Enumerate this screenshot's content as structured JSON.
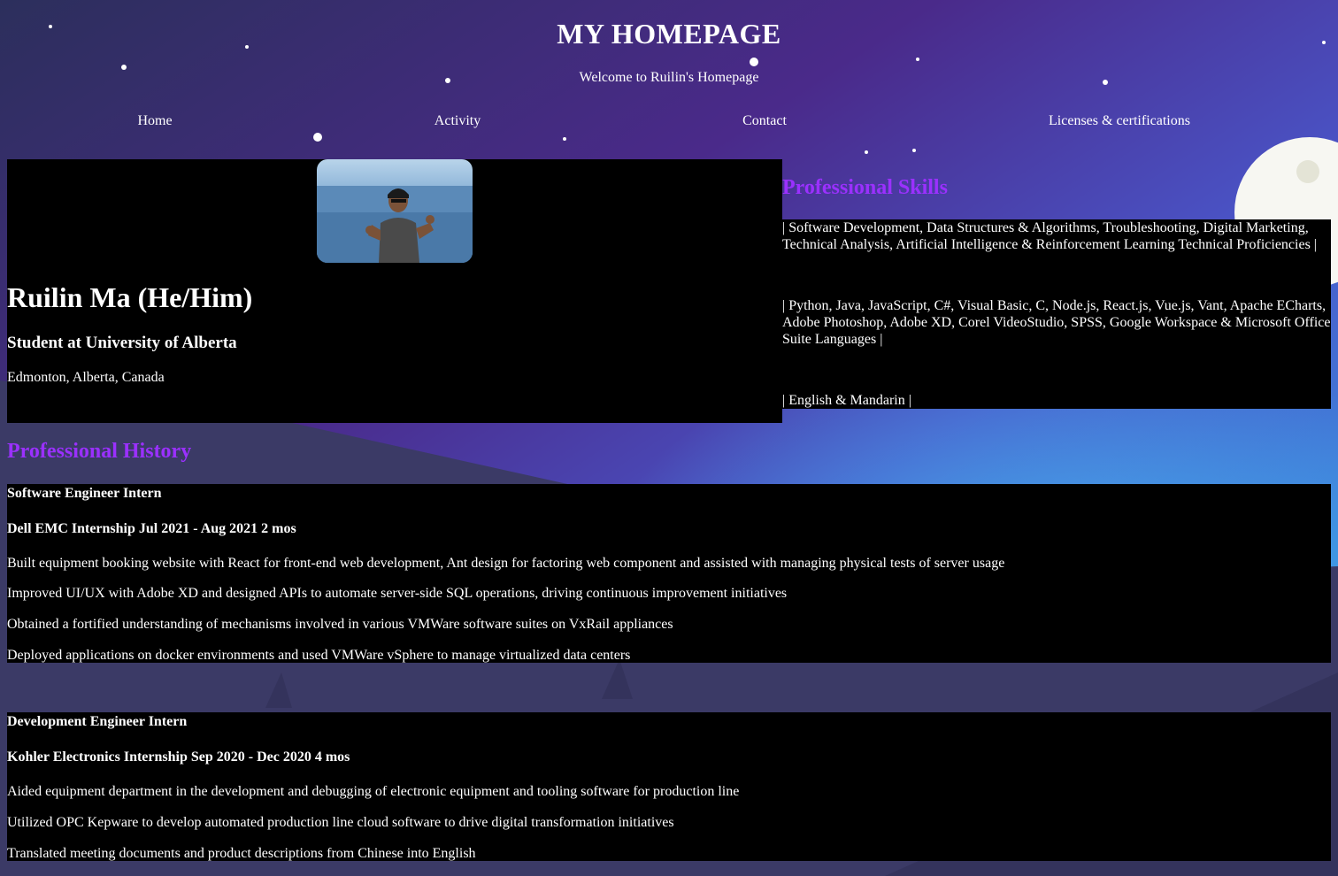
{
  "header": {
    "title": "MY HOMEPAGE",
    "subtitle": "Welcome to Ruilin's Homepage"
  },
  "nav": {
    "items": [
      {
        "label": "Home"
      },
      {
        "label": "Activity"
      },
      {
        "label": "Contact"
      },
      {
        "label": "Licenses & certifications"
      }
    ]
  },
  "profile": {
    "name": "Ruilin Ma (He/Him)",
    "headline": "Student at University of Alberta",
    "location": "Edmonton, Alberta, Canada"
  },
  "skills": {
    "title": "Professional Skills",
    "lines": [
      "| Software Development, Data Structures & Algorithms, Troubleshooting, Digital Marketing, Technical Analysis, Artificial Intelligence & Reinforcement Learning Technical Proficiencies |",
      "| Python, Java, JavaScript, C#, Visual Basic, C, Node.js, React.js, Vue.js, Vant, Apache ECharts, Adobe Photoshop, Adobe XD, Corel VideoStudio, SPSS, Google Workspace & Microsoft Office Suite Languages |",
      "| English & Mandarin |"
    ]
  },
  "history": {
    "title": "Professional History",
    "jobs": [
      {
        "role": "Software Engineer Intern",
        "company": "Dell EMC Internship Jul 2021 - Aug 2021 2 mos",
        "bullets": [
          "Built equipment booking website with React for front-end web development, Ant design for factoring web component and assisted with managing physical tests of server usage",
          "Improved UI/UX with Adobe XD and designed APIs to automate server-side SQL operations, driving continuous improvement initiatives",
          "Obtained a fortified understanding of mechanisms involved in various VMWare software suites on VxRail appliances",
          "Deployed applications on docker environments and used VMWare vSphere to manage virtualized data centers"
        ]
      },
      {
        "role": "Development Engineer Intern",
        "company": "Kohler Electronics Internship Sep 2020 - Dec 2020 4 mos",
        "bullets": [
          "Aided equipment department in the development and debugging of electronic equipment and tooling software for production line",
          "Utilized OPC Kepware to develop automated production line cloud software to drive digital transformation initiatives",
          "Translated meeting documents and product descriptions from Chinese into English"
        ]
      }
    ]
  },
  "colors": {
    "section_heading": "#9b30ff",
    "panel_background": "#000000",
    "text": "#ffffff"
  }
}
